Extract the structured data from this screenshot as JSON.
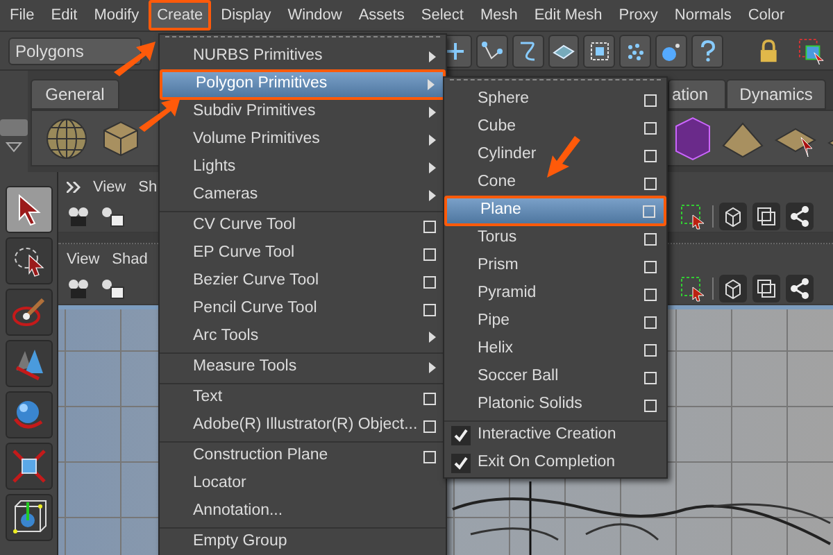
{
  "menu_bar": [
    {
      "label": "File",
      "selected": false
    },
    {
      "label": "Edit",
      "selected": false
    },
    {
      "label": "Modify",
      "selected": false
    },
    {
      "label": "Create",
      "selected": true
    },
    {
      "label": "Display",
      "selected": false
    },
    {
      "label": "Window",
      "selected": false
    },
    {
      "label": "Assets",
      "selected": false
    },
    {
      "label": "Select",
      "selected": false
    },
    {
      "label": "Mesh",
      "selected": false
    },
    {
      "label": "Edit Mesh",
      "selected": false
    },
    {
      "label": "Proxy",
      "selected": false
    },
    {
      "label": "Normals",
      "selected": false
    },
    {
      "label": "Color",
      "selected": false
    }
  ],
  "toolbar": {
    "mode_dropdown": "Polygons"
  },
  "shelf": {
    "tabs": [
      {
        "label": "General"
      },
      {
        "label": "ation"
      },
      {
        "label": "Dynamics"
      }
    ]
  },
  "tools": [
    {
      "kind": "select",
      "selected": true
    },
    {
      "kind": "lasso",
      "selected": false
    },
    {
      "kind": "paint",
      "selected": false
    },
    {
      "kind": "move",
      "selected": false
    },
    {
      "kind": "rotate",
      "selected": false
    },
    {
      "kind": "scale",
      "selected": false
    },
    {
      "kind": "manipulator",
      "selected": false
    }
  ],
  "panels": [
    {
      "menus": [
        "View",
        "Sh"
      ]
    },
    {
      "menus": [
        "View",
        "Shad"
      ]
    }
  ],
  "create_menu": {
    "groups": [
      {
        "items": [
          {
            "kind": "submenu",
            "label": "NURBS Primitives",
            "selected": false
          },
          {
            "kind": "submenu",
            "label": "Polygon Primitives",
            "selected": true
          },
          {
            "kind": "submenu",
            "label": "Subdiv Primitives",
            "selected": false
          },
          {
            "kind": "submenu",
            "label": "Volume Primitives",
            "selected": false
          },
          {
            "kind": "submenu",
            "label": "Lights",
            "selected": false
          },
          {
            "kind": "submenu",
            "label": "Cameras",
            "selected": false
          }
        ]
      },
      {
        "items": [
          {
            "kind": "option",
            "label": "CV Curve Tool",
            "selected": false
          },
          {
            "kind": "option",
            "label": "EP Curve Tool",
            "selected": false
          },
          {
            "kind": "option",
            "label": "Bezier Curve Tool",
            "selected": false
          },
          {
            "kind": "option",
            "label": "Pencil Curve Tool",
            "selected": false
          },
          {
            "kind": "submenu",
            "label": "Arc Tools",
            "selected": false
          }
        ]
      },
      {
        "items": [
          {
            "kind": "submenu",
            "label": "Measure Tools",
            "selected": false
          }
        ]
      },
      {
        "items": [
          {
            "kind": "option",
            "label": "Text",
            "selected": false
          },
          {
            "kind": "option",
            "label": "Adobe(R) Illustrator(R) Object...",
            "selected": false
          }
        ]
      },
      {
        "items": [
          {
            "kind": "option",
            "label": "Construction Plane",
            "selected": false
          },
          {
            "kind": "plain",
            "label": "Locator",
            "selected": false
          },
          {
            "kind": "plain",
            "label": "Annotation...",
            "selected": false
          }
        ]
      },
      {
        "items": [
          {
            "kind": "plain",
            "label": "Empty Group",
            "selected": false
          }
        ]
      }
    ]
  },
  "polygon_primitives_menu": {
    "groups": [
      {
        "items": [
          {
            "kind": "option",
            "label": "Sphere",
            "selected": false
          },
          {
            "kind": "option",
            "label": "Cube",
            "selected": false
          },
          {
            "kind": "option",
            "label": "Cylinder",
            "selected": false
          },
          {
            "kind": "option",
            "label": "Cone",
            "selected": false
          },
          {
            "kind": "option",
            "label": "Plane",
            "selected": true
          },
          {
            "kind": "option",
            "label": "Torus",
            "selected": false
          },
          {
            "kind": "option",
            "label": "Prism",
            "selected": false
          },
          {
            "kind": "option",
            "label": "Pyramid",
            "selected": false
          },
          {
            "kind": "option",
            "label": "Pipe",
            "selected": false
          },
          {
            "kind": "option",
            "label": "Helix",
            "selected": false
          },
          {
            "kind": "option",
            "label": "Soccer Ball",
            "selected": false
          },
          {
            "kind": "option",
            "label": "Platonic Solids",
            "selected": false
          }
        ]
      },
      {
        "items": [
          {
            "kind": "check",
            "label": "Interactive Creation",
            "selected": false,
            "checked": true
          },
          {
            "kind": "check",
            "label": "Exit On Completion",
            "selected": false,
            "checked": true
          }
        ]
      }
    ]
  }
}
